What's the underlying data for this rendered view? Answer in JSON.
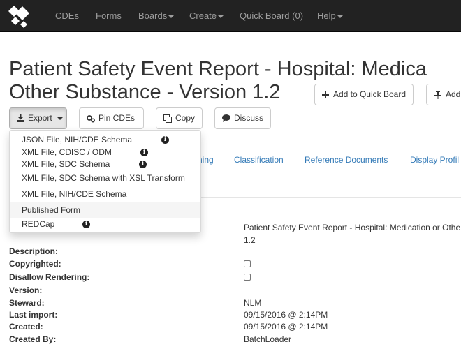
{
  "navbar": {
    "items": [
      {
        "label": "CDEs"
      },
      {
        "label": "Forms"
      },
      {
        "label": "Boards"
      },
      {
        "label": "Create"
      },
      {
        "label": "Quick Board (0)"
      },
      {
        "label": "Help"
      }
    ],
    "logo_icon": "nlm-cde-logo-icon"
  },
  "page": {
    "title_line1": "Patient Safety Event Report - Hospital: Medica",
    "title_line2": "Other Substance - Version 1.2"
  },
  "actions": {
    "add_quick_board": "Add to Quick Board",
    "add_board_partial": "Add t",
    "export": "Export",
    "pin_cdes": "Pin CDEs",
    "copy": "Copy",
    "discuss": "Discuss"
  },
  "export_menu": {
    "items": [
      {
        "label": "JSON File, NIH/CDE Schema",
        "info": true
      },
      {
        "label": "XML File, CDISC / ODM",
        "info": true
      },
      {
        "label": "XML File, SDC Schema",
        "info": true
      },
      {
        "label": "XML File, SDC Schema with XSL Transform",
        "info": false
      },
      {
        "label": "XML File, NIH/CDE Schema",
        "info": false
      },
      {
        "label": "Published Form",
        "info": false,
        "hover": true
      },
      {
        "label": "REDCap",
        "info": true
      }
    ]
  },
  "tabs": [
    {
      "label": "ning"
    },
    {
      "label": "Classification"
    },
    {
      "label": "Reference Documents"
    },
    {
      "label": "Display Profil"
    }
  ],
  "details": {
    "name_value_line1": "Patient Safety Event Report - Hospital: Medication or Othe",
    "name_value_line2": "1.2",
    "fields": [
      {
        "label": "Description:",
        "value": ""
      },
      {
        "label": "Copyrighted:",
        "checkbox": true,
        "checked": false
      },
      {
        "label": "Disallow Rendering:",
        "checkbox": true,
        "checked": false
      },
      {
        "label": "Version:",
        "value": ""
      },
      {
        "label": "Steward:",
        "value": "NLM"
      },
      {
        "label": "Last import:",
        "value": "09/15/2016 @ 2:14PM"
      },
      {
        "label": "Created:",
        "value": "09/15/2016 @ 2:14PM"
      },
      {
        "label": "Created By:",
        "value": "BatchLoader"
      }
    ]
  }
}
